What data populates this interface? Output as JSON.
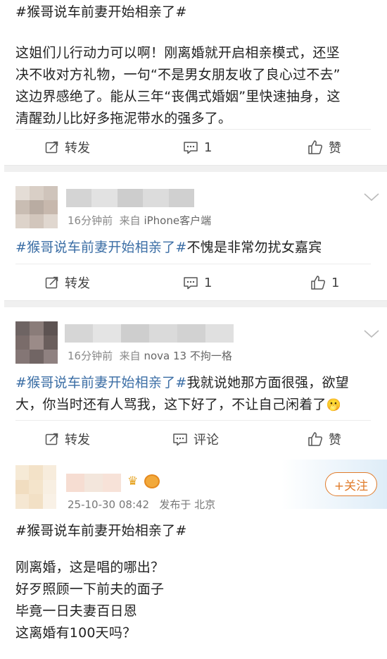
{
  "post1": {
    "hashtag": "#猴哥说车前妻开始相亲了#",
    "lines": [
      "这姐们儿行动力可以啊！刚离婚就开启相亲模式，还坚",
      "决不收对方礼物，一句“不是男女朋友收了良心过不去”",
      "这边界感绝了。能从三年“丧偶式婚姻”里快速抽身，这",
      "清醒劲儿比好多拖泥带水的强多了。"
    ],
    "actions": {
      "repost": "转发",
      "comment_count": "1",
      "like": "赞"
    }
  },
  "comment2": {
    "time": "16分钟前",
    "source_prefix": "来自",
    "device": "iPhone客户端",
    "hashtag": "#猴哥说车前妻开始相亲了#",
    "text": "不愧是非常勿扰女嘉宾",
    "actions": {
      "repost": "转发",
      "comment_count": "1",
      "like_count": "1"
    }
  },
  "comment3": {
    "time": "16分钟前",
    "source_prefix": "来自",
    "device": "nova 13 不拘一格",
    "hashtag": "#猴哥说车前妻开始相亲了#",
    "text_line1": "我就说她那方面很强，欲望",
    "text_line2": "大，你当时还有人骂我，这下好了，不让自己闲着了",
    "emoji": "🫢",
    "actions": {
      "repost": "转发",
      "comment": "评论",
      "like": "赞"
    }
  },
  "post4": {
    "follow": "+关注",
    "datetime": "25-10-30 08:42",
    "location_label": "发布于 北京",
    "hashtag": "#猴哥说车前妻开始相亲了#",
    "lines": [
      "刚离婚，这是唱的哪出？",
      "好歹照顾一下前夫的面子",
      "毕竟一日夫妻百日恩",
      "这离婚有100天吗？"
    ]
  },
  "colors": {
    "hashtag": "#3b6ea5",
    "follow_accent": "#e07b2a",
    "divider": "#f0f0f0"
  },
  "icons": [
    "repost-icon",
    "comment-icon",
    "like-icon",
    "chevron-down-icon",
    "crown-icon",
    "emoji-icon"
  ]
}
